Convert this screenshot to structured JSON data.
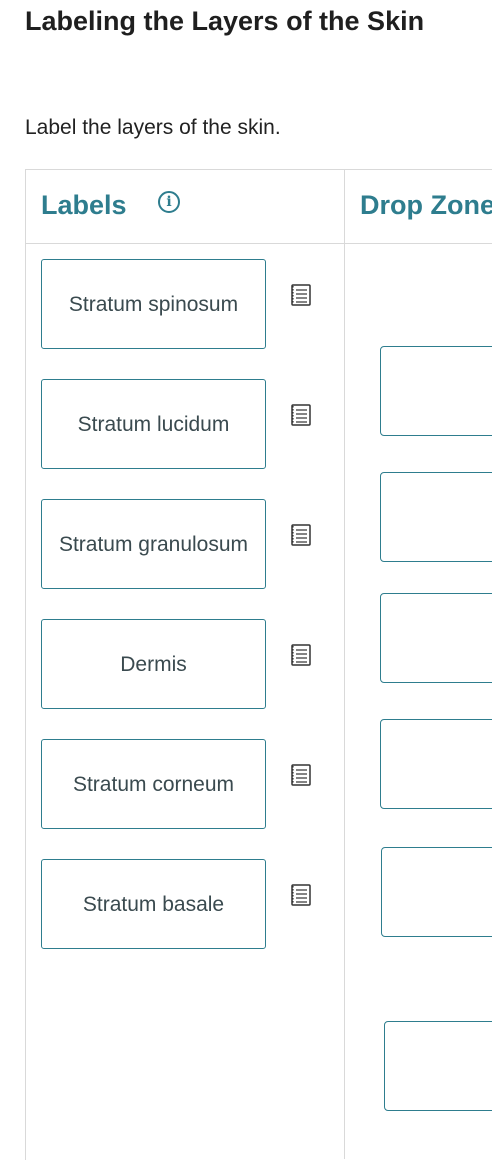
{
  "page": {
    "title": "Labeling the Layers of the Skin",
    "instructions": "Label the layers of the skin."
  },
  "columns": {
    "labels_heading": "Labels",
    "dropzone_heading": "Drop Zone"
  },
  "icons": {
    "info": "info-icon",
    "note": "notepad-icon"
  },
  "labels": [
    {
      "text": "Stratum spinosum"
    },
    {
      "text": "Stratum lucidum"
    },
    {
      "text": "Stratum granulosum"
    },
    {
      "text": "Dermis"
    },
    {
      "text": "Stratum corneum"
    },
    {
      "text": "Stratum basale"
    }
  ],
  "drop_zones": [
    {
      "value": ""
    },
    {
      "value": ""
    },
    {
      "value": ""
    },
    {
      "value": ""
    },
    {
      "value": ""
    },
    {
      "value": ""
    }
  ],
  "colors": {
    "accent": "#2e7d8e",
    "divider": "#d9d9d9"
  }
}
